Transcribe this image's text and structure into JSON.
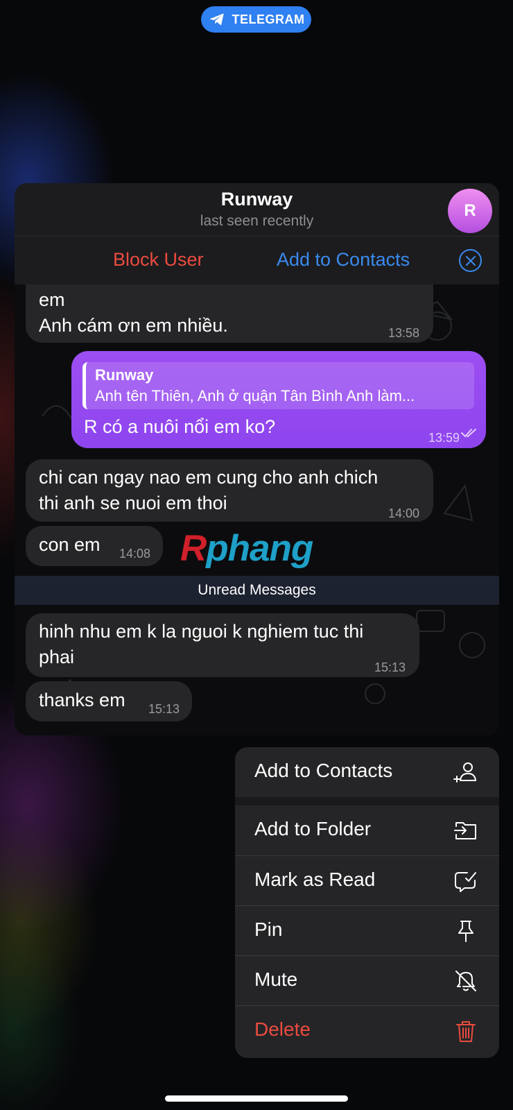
{
  "app": {
    "badge": "TELEGRAM"
  },
  "header": {
    "name": "Runway",
    "status": "last seen recently",
    "avatar_letter": "R"
  },
  "actions": {
    "block": "Block User",
    "add_contacts": "Add to Contacts"
  },
  "messages": [
    {
      "line1": "em",
      "line2": "Anh cám ơn em nhiều.",
      "time": "13:58"
    },
    {
      "quote_name": "Runway",
      "quote_text": "Anh tên Thiên, Anh ở quận Tân Bình Anh làm...",
      "text": "R có a nuôi nổi em ko?",
      "time": "13:59"
    },
    {
      "line1": "chi can ngay nao em cung cho anh chich",
      "line2": "thi anh se nuoi em thoi",
      "time": "14:00"
    },
    {
      "text": "con em",
      "time": "14:08"
    },
    {
      "line1": "hinh nhu em k la nguoi k nghiem tuc thi",
      "line2": "phai",
      "time": "15:13"
    },
    {
      "text": "thanks em",
      "time": "15:13"
    }
  ],
  "watermark": {
    "first": "R",
    "rest": "phang"
  },
  "unread_label": "Unread Messages",
  "menu": {
    "add_contacts": "Add to Contacts",
    "add_folder": "Add to Folder",
    "mark_read": "Mark as Read",
    "pin": "Pin",
    "mute": "Mute",
    "delete": "Delete"
  },
  "colors": {
    "accent": "#3a8bf0",
    "danger": "#ec4b3f",
    "outgoing": "#9d4ef2"
  }
}
